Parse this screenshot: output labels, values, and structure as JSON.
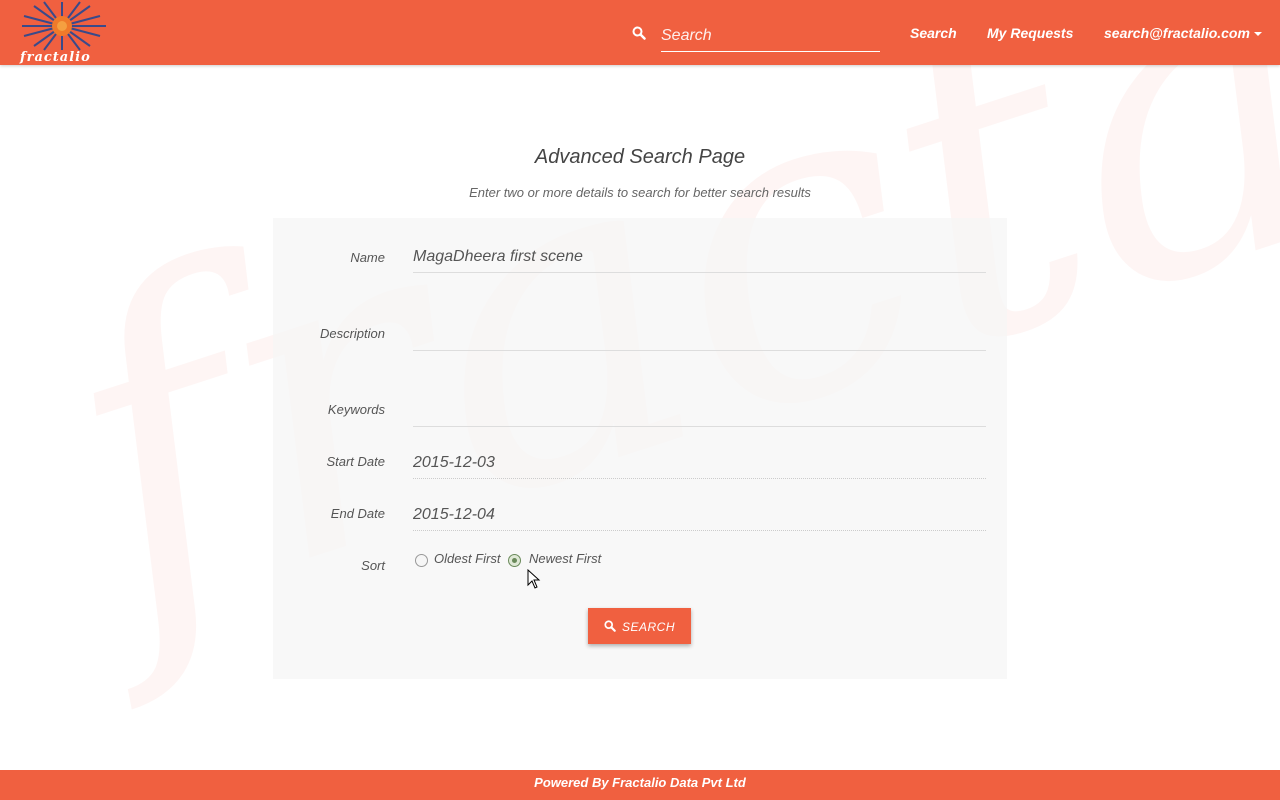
{
  "brand": {
    "logo_text": "fractalio",
    "watermark_text": "fractalio",
    "accent_color": "#f06040"
  },
  "header": {
    "search_placeholder": "Search",
    "nav": {
      "search_label": "Search",
      "my_requests_label": "My Requests",
      "user_email": "search@fractalio.com"
    }
  },
  "page": {
    "title": "Advanced Search Page",
    "subtitle": "Enter two or more details to search for better search results"
  },
  "form": {
    "name_label": "Name",
    "name_value": "MagaDheera first scene",
    "description_label": "Description",
    "description_value": "",
    "keywords_label": "Keywords",
    "keywords_value": "",
    "start_date_label": "Start Date",
    "start_date_value": "2015-12-03",
    "end_date_label": "End Date",
    "end_date_value": "2015-12-04",
    "sort_label": "Sort",
    "sort_options": [
      "Oldest First",
      "Newest First"
    ],
    "sort_selected": "Newest First",
    "submit_label": "SEARCH"
  },
  "footer": {
    "text": "Powered By Fractalio Data Pvt Ltd"
  },
  "icons": {
    "header_search": "search-icon",
    "button_search": "search-icon",
    "dropdown": "caret-down-icon",
    "cursor": "mouse-pointer-icon"
  }
}
